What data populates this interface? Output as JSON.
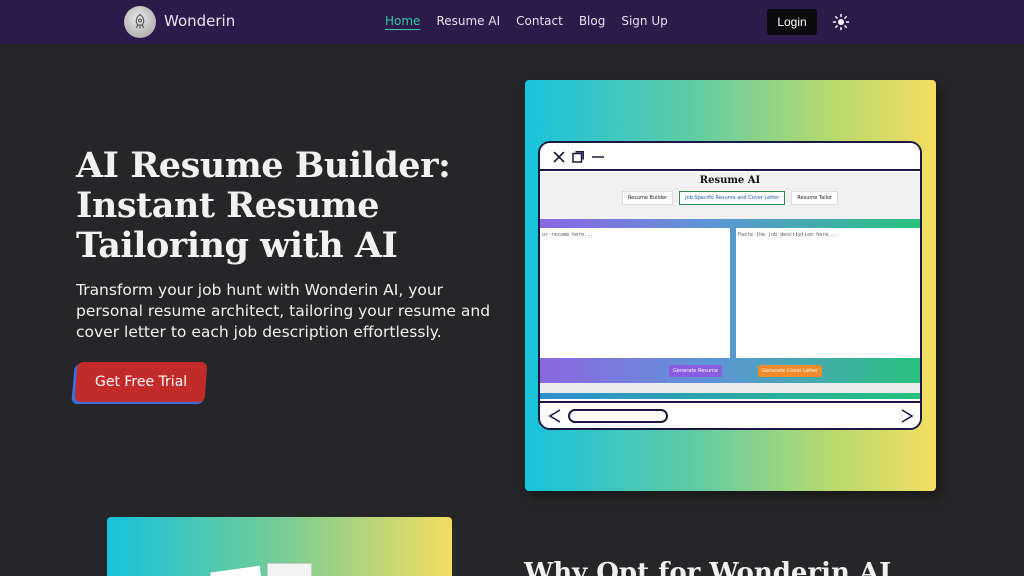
{
  "nav": {
    "brand": "Wonderin",
    "links": [
      "Home",
      "Resume AI",
      "Contact",
      "Blog",
      "Sign Up"
    ],
    "login": "Login",
    "logo_icon": "rocket-icon",
    "theme_icon": "sun-icon"
  },
  "hero": {
    "title": "AI Resume Builder: Instant Resume Tailoring with AI",
    "subtitle": "Transform your job hunt with Wonderin AI, your personal resume architect, tailoring your resume and cover letter to each job description effortlessly.",
    "cta": "Get Free Trial"
  },
  "preview": {
    "app_title": "Resume AI",
    "tabs": [
      "Resume Builder",
      "Job Specific Resume and Cover Letter",
      "Resume Tailor"
    ],
    "resume_placeholder": "ur resume here...",
    "job_placeholder": "Paste the job description here...",
    "generate_resume": "Generate Resume",
    "generate_cover": "Generate Cover Letter"
  },
  "section2": {
    "heading": "Why Opt for Wonderin AI"
  },
  "colors": {
    "nav_bg": "#2b1a4a",
    "page_bg": "#262628",
    "accent_active": "#35c9a6",
    "cta_red": "#c32b2a",
    "cta_blue": "#3a6fe0"
  }
}
